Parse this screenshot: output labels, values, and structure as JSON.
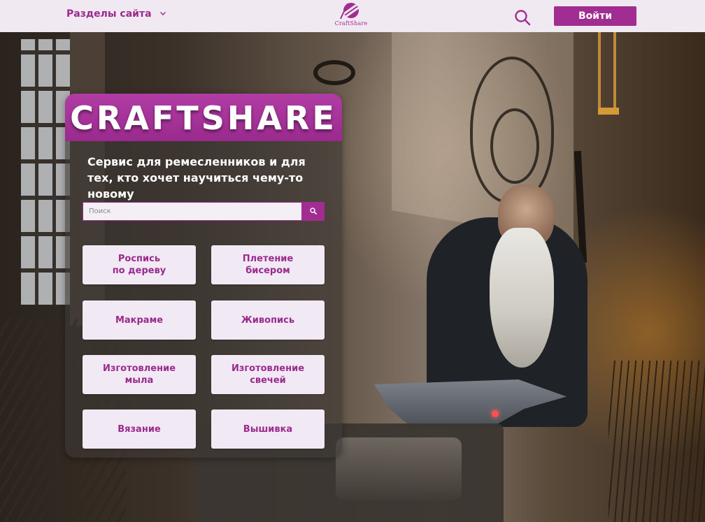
{
  "header": {
    "sections_label": "Разделы сайта",
    "logo_text": "CraftShare",
    "login_label": "Войти"
  },
  "hero": {
    "title": "CRAFTSHARE",
    "tagline": "Сервис для ремесленников  и для тех, кто хочет научиться чему-то новому"
  },
  "search": {
    "placeholder": "Поиск",
    "value": ""
  },
  "categories": [
    {
      "label": "Роспись\nпо дереву"
    },
    {
      "label": "Плетение\nбисером"
    },
    {
      "label": "Макраме"
    },
    {
      "label": "Живопись"
    },
    {
      "label": "Изготовление\nмыла"
    },
    {
      "label": "Изготовление\nсвечей"
    },
    {
      "label": "Вязание"
    },
    {
      "label": "Вышивка"
    }
  ],
  "colors": {
    "accent": "#a12d93",
    "header_bg": "#f1e9f2",
    "card_bg": "#f1e9f3"
  },
  "icons": {
    "header_search": "search-icon",
    "input_search": "search-icon",
    "dropdown": "chevron-down-icon",
    "logo": "yarn-ball-icon"
  }
}
